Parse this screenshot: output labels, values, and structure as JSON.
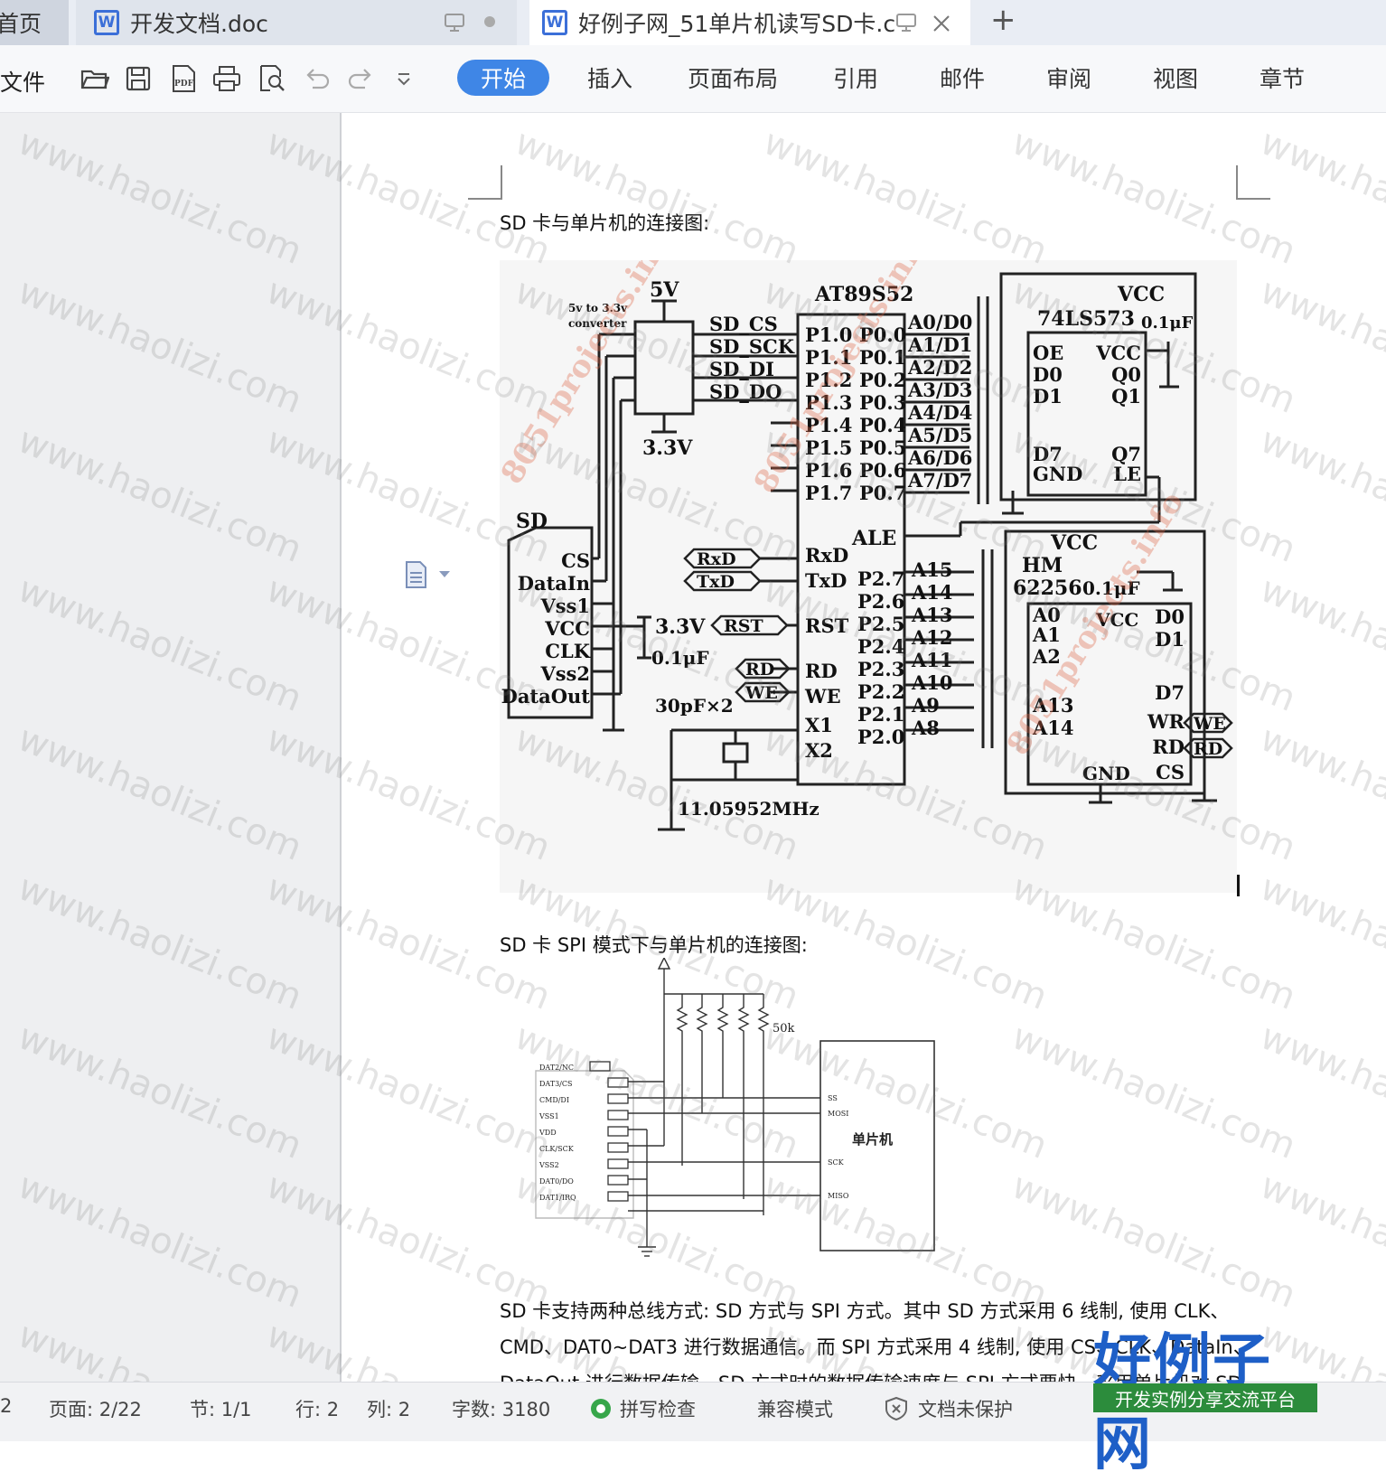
{
  "tabs": {
    "home": "首页",
    "doc1": "开发文档.doc",
    "doc2": "好例子网_51单片机读写SD卡.c"
  },
  "ribbon": {
    "file": "文件",
    "menu": [
      "开始",
      "插入",
      "页面布局",
      "引用",
      "邮件",
      "审阅",
      "视图",
      "章节"
    ]
  },
  "document": {
    "caption1": "SD 卡与单片机的连接图:",
    "caption2": "SD 卡 SPI 模式下与单片机的连接图:",
    "para_line1": "SD 卡支持两种总线方式:  SD 方式与 SPI 方式。其中 SD 方式采用 6 线制,  使用 CLK、",
    "para_line2": "CMD、DAT0~DAT3 进行数据通信。而 SPI 方式采用 4 线制,  使用 CS、CLK、DataIn、",
    "para_line3": "DataOut 进行数据传输。SD 方式时的数据传输速度与 SPI 方式要快，采用单片机对 SD",
    "watermark": "www.haolizi.com"
  },
  "circuit1": {
    "mcu": "AT89S52",
    "latch": "74LS573",
    "ram_name1": "HM",
    "ram_name2": "62256",
    "sd": "SD",
    "v5": "5V",
    "v33": "3.3V",
    "v33b": "3.3V",
    "conv1": "5v to 3.3v",
    "conv2": "converter",
    "vcc1": "VCC",
    "vcc2": "VCC",
    "cap1": "0.1μF",
    "cap2": "0.1μF",
    "cap3": "0.1μF",
    "xtal_caps": "30pF×2",
    "xtal": "11.05952MHz",
    "sd_signals": [
      "SD_CS",
      "SD_SCK",
      "SD_DI",
      "SD_DO"
    ],
    "sd_pins": [
      "CS",
      "DataIn",
      "Vss1",
      "VCC",
      "CLK",
      "Vss2",
      "DataOut"
    ],
    "p1": [
      "P1.0",
      "P1.1",
      "P1.2",
      "P1.3",
      "P1.4",
      "P1.5",
      "P1.6",
      "P1.7"
    ],
    "p0": [
      "P0.0",
      "P0.1",
      "P0.2",
      "P0.3",
      "P0.4",
      "P0.5",
      "P0.6",
      "P0.7"
    ],
    "ad": [
      "A0/D0",
      "A1/D1",
      "A2/D2",
      "A3/D3",
      "A4/D4",
      "A5/D5",
      "A6/D6",
      "A7/D7"
    ],
    "p2": [
      "P2.7",
      "P2.6",
      "P2.5",
      "P2.4",
      "P2.3",
      "P2.2",
      "P2.1",
      "P2.0"
    ],
    "addr": [
      "A15",
      "A14",
      "A13",
      "A12",
      "A11",
      "A10",
      "A9",
      "A8"
    ],
    "mcu_left": [
      "RxD",
      "TxD",
      "RST",
      "RD",
      "WE",
      "X1",
      "X2"
    ],
    "ale": "ALE",
    "ports": [
      "RxD",
      "TxD",
      "RST",
      "RD",
      "WE"
    ],
    "latch_left": [
      "OE",
      "D0",
      "D1",
      "D7",
      "GND"
    ],
    "latch_right": [
      "VCC",
      "Q0",
      "Q1",
      "Q7",
      "LE"
    ],
    "ram_left": [
      "A0",
      "A1",
      "A2",
      "A13",
      "A14"
    ],
    "ram_right": [
      "D0",
      "D1",
      "D7",
      "WR",
      "RD",
      "CS"
    ],
    "ram_vcc": "VCC",
    "ram_gnd": "GND",
    "ram_ports": [
      "WE",
      "RD"
    ],
    "watermark": "8051projects.info"
  },
  "circuit2": {
    "res": "50k",
    "mcu": "单片机",
    "card_pins": [
      "DAT2/NC",
      "DAT3/CS",
      "CMD/DI",
      "VSS1",
      "VDD",
      "CLK/SCK",
      "VSS2",
      "DAT0/DO",
      "DAT1/IRQ"
    ],
    "mcu_pins": [
      "SS",
      "MOSI",
      "SCK",
      "MISO"
    ]
  },
  "status": {
    "section_prev": "2",
    "page": "页面: 2/22",
    "section": "节: 1/1",
    "row": "行: 2",
    "col": "列: 2",
    "words": "字数: 3180",
    "spell": "拼写检查",
    "compat": "兼容模式",
    "protect": "文档未保护"
  },
  "logo": {
    "main": "好例子网",
    "sub": "开发实例分享交流平台"
  }
}
